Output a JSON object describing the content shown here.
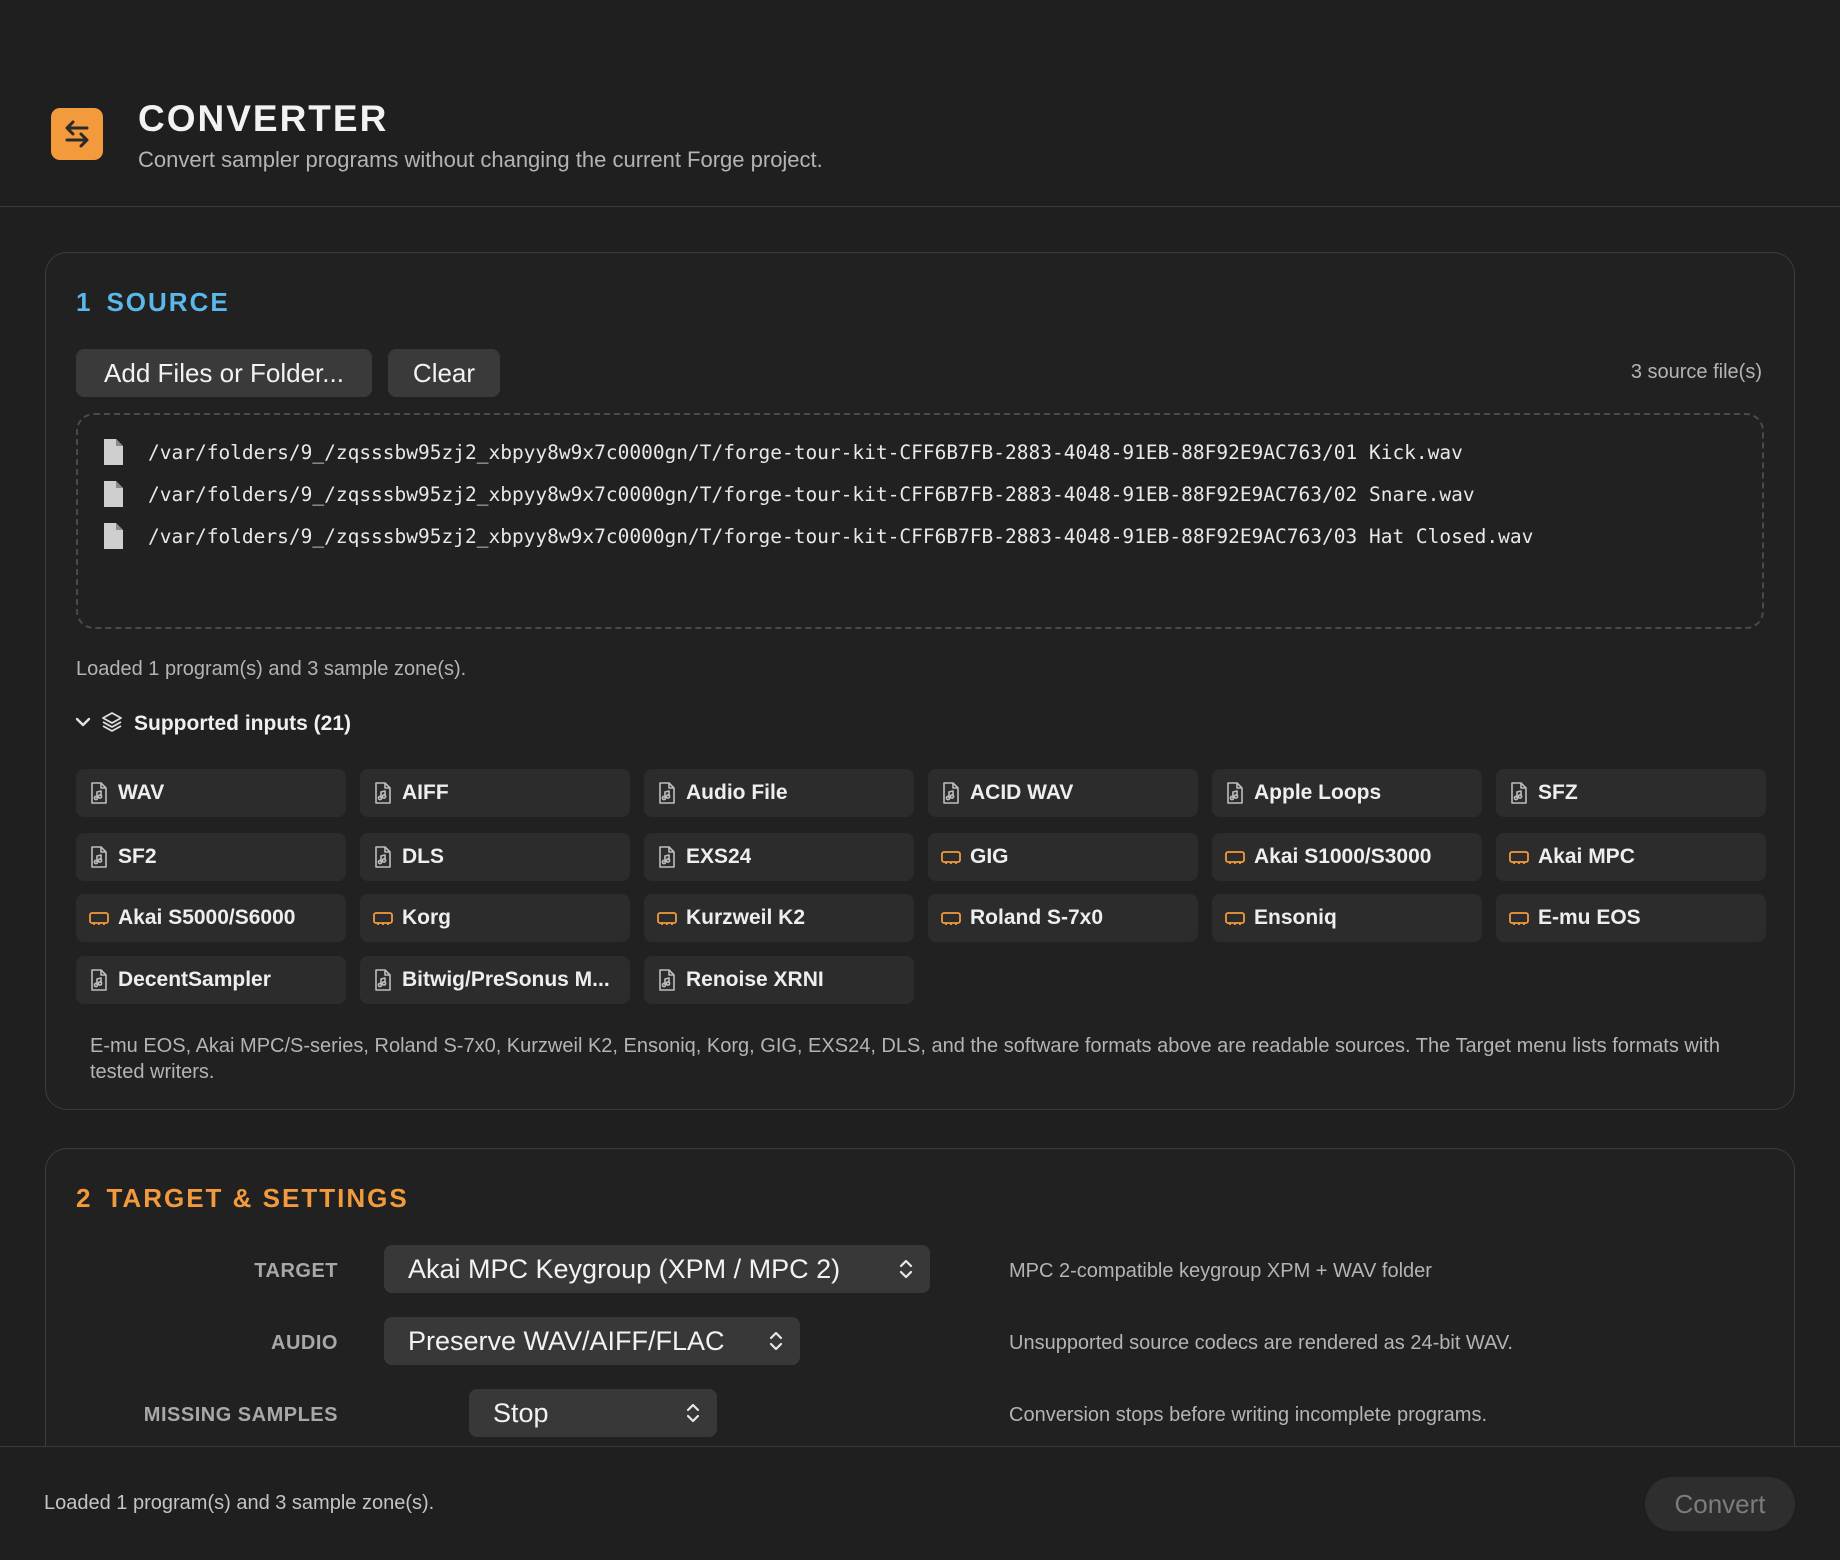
{
  "header": {
    "title": "CONVERTER",
    "subtitle": "Convert sampler programs without changing the current Forge project."
  },
  "source": {
    "number": "1",
    "title": "SOURCE",
    "add_button": "Add Files or Folder...",
    "clear_button": "Clear",
    "file_count": "3 source file(s)",
    "files": [
      "/var/folders/9_/zqsssbw95zj2_xbpyy8w9x7c0000gn/T/forge-tour-kit-CFF6B7FB-2883-4048-91EB-88F92E9AC763/01 Kick.wav",
      "/var/folders/9_/zqsssbw95zj2_xbpyy8w9x7c0000gn/T/forge-tour-kit-CFF6B7FB-2883-4048-91EB-88F92E9AC763/02 Snare.wav",
      "/var/folders/9_/zqsssbw95zj2_xbpyy8w9x7c0000gn/T/forge-tour-kit-CFF6B7FB-2883-4048-91EB-88F92E9AC763/03 Hat Closed.wav"
    ],
    "loaded_note": "Loaded 1 program(s) and 3 sample zone(s).",
    "supported_label": "Supported inputs (21)",
    "formats": [
      {
        "label": "WAV",
        "icon": "audio-file-icon"
      },
      {
        "label": "AIFF",
        "icon": "audio-file-icon"
      },
      {
        "label": "Audio File",
        "icon": "audio-file-icon"
      },
      {
        "label": "ACID WAV",
        "icon": "audio-file-icon"
      },
      {
        "label": "Apple Loops",
        "icon": "audio-file-icon"
      },
      {
        "label": "SFZ",
        "icon": "audio-file-icon"
      },
      {
        "label": "SF2",
        "icon": "audio-file-icon"
      },
      {
        "label": "DLS",
        "icon": "audio-file-icon"
      },
      {
        "label": "EXS24",
        "icon": "audio-file-icon"
      },
      {
        "label": "GIG",
        "icon": "hardware-icon"
      },
      {
        "label": "Akai S1000/S3000",
        "icon": "hardware-icon"
      },
      {
        "label": "Akai MPC",
        "icon": "hardware-icon"
      },
      {
        "label": "Akai S5000/S6000",
        "icon": "hardware-icon"
      },
      {
        "label": "Korg",
        "icon": "hardware-icon"
      },
      {
        "label": "Kurzweil K2",
        "icon": "hardware-icon"
      },
      {
        "label": "Roland S-7x0",
        "icon": "hardware-icon"
      },
      {
        "label": "Ensoniq",
        "icon": "hardware-icon"
      },
      {
        "label": "E-mu EOS",
        "icon": "hardware-icon"
      },
      {
        "label": "DecentSampler",
        "icon": "audio-file-icon"
      },
      {
        "label": "Bitwig/PreSonus M...",
        "icon": "audio-file-icon"
      },
      {
        "label": "Renoise XRNI",
        "icon": "audio-file-icon"
      }
    ],
    "footnote": "E-mu EOS, Akai MPC/S-series, Roland S-7x0, Kurzweil K2, Ensoniq, Korg, GIG, EXS24, DLS, and the software formats above are readable sources. The Target menu lists formats with tested writers."
  },
  "target": {
    "number": "2",
    "title": "TARGET & SETTINGS",
    "target_label": "TARGET",
    "target_value": "Akai MPC Keygroup (XPM / MPC 2)",
    "target_desc": "MPC 2-compatible keygroup XPM + WAV folder",
    "audio_label": "AUDIO",
    "audio_value": "Preserve WAV/AIFF/FLAC",
    "audio_desc": "Unsupported source codecs are rendered as 24-bit WAV.",
    "missing_label": "MISSING SAMPLES",
    "missing_value": "Stop",
    "missing_desc": "Conversion stops before writing incomplete programs."
  },
  "footer": {
    "status": "Loaded 1 program(s) and 3 sample zone(s).",
    "convert_button": "Convert"
  },
  "colors": {
    "accent_orange": "#f39a3c",
    "accent_blue": "#5ab8ea",
    "background": "#1f1f1f"
  }
}
